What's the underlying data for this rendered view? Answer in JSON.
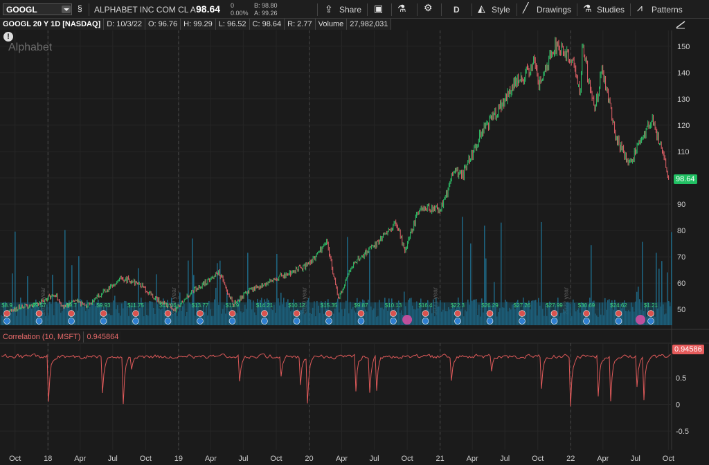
{
  "toolbar": {
    "symbol": "GOOGL",
    "company": "ALPHABET INC COM CL A",
    "last": "98.64",
    "change_pct": "0.00%",
    "change_abs": "0",
    "bid": "B: 98.80",
    "ask": "A: 99.26",
    "share": "Share",
    "aggregation": "D",
    "style": "Style",
    "drawings": "Drawings",
    "studies": "Studies",
    "patterns": "Patterns"
  },
  "infobar": {
    "title": "GOOGL 20 Y 1D [NASDAQ]",
    "date": "D: 10/3/22",
    "open": "O: 96.76",
    "high": "H: 99.29",
    "low": "L: 96.52",
    "close": "C: 98.64",
    "range": "R: 2.77",
    "volume_label": "Volume",
    "volume": "27,982,031"
  },
  "watermark": "Alphabet",
  "price_badge": "98.64",
  "correlation": {
    "label": "Correlation (10, MSFT)",
    "value": "0.945864",
    "badge": "0.94586"
  },
  "colors": {
    "up": "#2fc56a",
    "down": "#e8636a",
    "volume": "#1f6f8f",
    "correlation": "#e05a5a"
  },
  "chart_data": [
    {
      "type": "line",
      "x_ticks": [
        "Oct",
        "18",
        "Apr",
        "Jul",
        "Oct",
        "19",
        "Apr",
        "Jul",
        "Oct",
        "20",
        "Apr",
        "Jul",
        "Oct",
        "21",
        "Apr",
        "Jul",
        "Oct",
        "22",
        "Apr",
        "Jul",
        "Oct"
      ],
      "y_ticks": [
        50,
        60,
        70,
        80,
        90,
        100,
        110,
        120,
        130,
        140,
        150
      ],
      "ylim": [
        44,
        156
      ],
      "year_markers": [
        "2018 year",
        "2019 year",
        "2020 year",
        "2021 year",
        "2022 year"
      ],
      "dividend_labels": [
        "$8.9",
        "$9.57",
        "$9.7",
        "$9.93",
        "$11.75",
        "$13.06",
        "$13.77",
        "$11.9",
        "$14.21",
        "$10.12",
        "$15.35",
        "$9.87",
        "$10.13",
        "$16.4",
        "$22.3",
        "$26.29",
        "$27.26",
        "$27.99",
        "$30.69",
        "$24.62",
        "$1.21"
      ],
      "price": [
        [
          "2017-09-01",
          48
        ],
        [
          "2017-10-15",
          51
        ],
        [
          "2017-12-01",
          52
        ],
        [
          "2018-01-20",
          56
        ],
        [
          "2018-02-10",
          51
        ],
        [
          "2018-03-20",
          53
        ],
        [
          "2018-04-20",
          51
        ],
        [
          "2018-06-01",
          56
        ],
        [
          "2018-07-25",
          62
        ],
        [
          "2018-08-20",
          61
        ],
        [
          "2018-09-20",
          59
        ],
        [
          "2018-10-30",
          54
        ],
        [
          "2018-12-24",
          50
        ],
        [
          "2019-02-01",
          56
        ],
        [
          "2019-04-25",
          64
        ],
        [
          "2019-06-03",
          52
        ],
        [
          "2019-07-15",
          57
        ],
        [
          "2019-08-20",
          59
        ],
        [
          "2019-10-20",
          63
        ],
        [
          "2019-12-31",
          67
        ],
        [
          "2020-02-19",
          76
        ],
        [
          "2020-03-23",
          54
        ],
        [
          "2020-05-01",
          67
        ],
        [
          "2020-07-15",
          76
        ],
        [
          "2020-09-01",
          83
        ],
        [
          "2020-09-25",
          72
        ],
        [
          "2020-11-05",
          89
        ],
        [
          "2020-12-31",
          88
        ],
        [
          "2021-01-25",
          96
        ],
        [
          "2021-02-05",
          103
        ],
        [
          "2021-03-05",
          101
        ],
        [
          "2021-04-30",
          118
        ],
        [
          "2021-06-15",
          126
        ],
        [
          "2021-07-28",
          136
        ],
        [
          "2021-08-20",
          138
        ],
        [
          "2021-09-20",
          144
        ],
        [
          "2021-10-05",
          136
        ],
        [
          "2021-11-18",
          150
        ],
        [
          "2022-01-05",
          145
        ],
        [
          "2022-01-28",
          133
        ],
        [
          "2022-02-02",
          150
        ],
        [
          "2022-03-08",
          126
        ],
        [
          "2022-03-30",
          141
        ],
        [
          "2022-05-10",
          114
        ],
        [
          "2022-06-16",
          106
        ],
        [
          "2022-08-16",
          122
        ],
        [
          "2022-09-12",
          111
        ],
        [
          "2022-10-03",
          98.64
        ]
      ],
      "volume_note": "volume histogram shown in background"
    },
    {
      "type": "line",
      "name": "Correlation (10, MSFT)",
      "y_ticks": [
        -0.5,
        0,
        0.5
      ],
      "ylim": [
        -0.85,
        1.15
      ],
      "last_value": 0.945864
    }
  ]
}
